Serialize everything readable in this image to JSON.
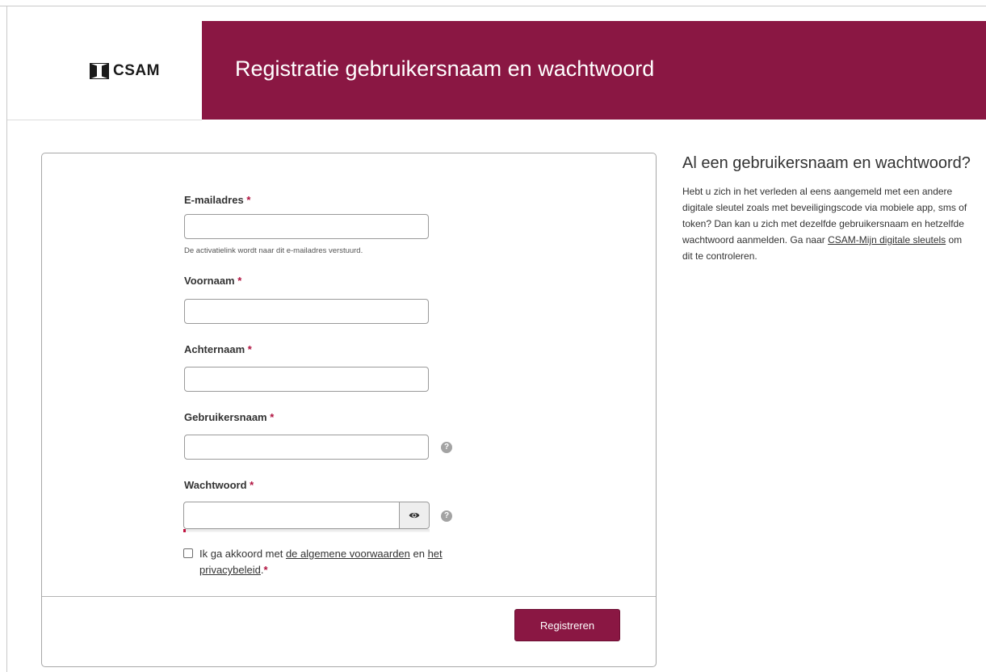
{
  "header": {
    "logo_text": "CSAM",
    "title": "Registratie gebruikersnaam en wachtwoord"
  },
  "form": {
    "required_marker": "*",
    "email": {
      "label": "E-mailadres",
      "value": "",
      "hint": "De activatielink wordt naar dit e-mailadres verstuurd."
    },
    "firstname": {
      "label": "Voornaam",
      "value": ""
    },
    "lastname": {
      "label": "Achternaam",
      "value": ""
    },
    "username": {
      "label": "Gebruikersnaam",
      "value": "",
      "help_icon": "question-circle-icon"
    },
    "password": {
      "label": "Wachtwoord",
      "value": "",
      "toggle_icon": "eye-icon",
      "help_icon": "question-circle-icon"
    },
    "agree": {
      "checked": false,
      "prefix": "Ik ga akkoord met ",
      "terms_link": "de algemene voorwaarden",
      "middle": " en ",
      "privacy_link": "het privacybeleid",
      "suffix": "."
    },
    "submit_label": "Registreren"
  },
  "sidebar": {
    "title": "Al een gebruikersnaam en wachtwoord?",
    "text": "Hebt u zich in het verleden al eens aangemeld met een andere digitale sleutel zoals met beveiligingscode via mobiele app, sms of token? Dan kan u zich met dezelfde gebruikersnaam en hetzelfde wachtwoord aanmelden. Ga naar ",
    "link": "CSAM-Mijn digitale sleutels",
    "text_after": " om dit te controleren."
  },
  "colors": {
    "brand": "#8a1743",
    "required": "#b0123f",
    "border": "#9a9a9a"
  }
}
